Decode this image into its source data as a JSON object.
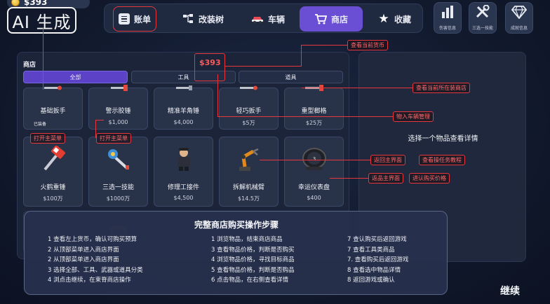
{
  "currency": {
    "amount": "$393"
  },
  "watermark": {
    "text": "AI 生成"
  },
  "nav": {
    "tabs": [
      {
        "label": "账单",
        "icon": "bill-icon"
      },
      {
        "label": "改装树",
        "icon": "tree-icon"
      },
      {
        "label": "车辆",
        "icon": "car-icon"
      },
      {
        "label": "商店",
        "icon": "cart-icon",
        "active": true
      },
      {
        "label": "收藏",
        "icon": "star-icon"
      }
    ],
    "right_buttons": [
      {
        "label": "伤害信息",
        "icon": "bar-chart-icon"
      },
      {
        "label": "三选一技能",
        "icon": "tools-icon"
      },
      {
        "label": "成就信息",
        "icon": "diamond-icon"
      }
    ]
  },
  "shop": {
    "title": "商店",
    "filters": [
      "全部",
      "工具",
      "道具"
    ],
    "items_row1": [
      {
        "name": "基础扳手",
        "price": "",
        "badge": "已装备"
      },
      {
        "name": "警示胶锤",
        "price": "$1,000"
      },
      {
        "name": "精准羊角锤",
        "price": "$4,000"
      },
      {
        "name": "轻巧扳手",
        "price": "$5万"
      },
      {
        "name": "重型榔格",
        "price": "$25万"
      }
    ],
    "items_row2": [
      {
        "name": "火鹤重锤",
        "price": "$100万",
        "icon": "hammer-icon"
      },
      {
        "name": "三选一技能",
        "price": "$1000万",
        "icon": "mace-icon"
      },
      {
        "name": "修理工接件",
        "price": "$4,500",
        "icon": "mechanic-icon"
      },
      {
        "name": "拆解机械臂",
        "price": "$14.5万",
        "icon": "robot-arm-icon"
      },
      {
        "name": "幸运仪表盘",
        "price": "$400",
        "icon": "gauge-icon"
      }
    ]
  },
  "detail": {
    "hint": "选择一个物品查看详情"
  },
  "guide": {
    "title": "完整商店购买操作步骤",
    "col1": [
      "1 查看左上货币，确认可购买预算",
      "2 从顶部菜单进入商店界面",
      "2 从顶部菜单进入商店界面",
      "3 选择全部、工具、武器或道具分类",
      "4 浏点击继续，在束脊商店操作"
    ],
    "col2": [
      "1 浏览物品，结束商店商品",
      "3 查看物品价格，判断是否购买",
      "4 浏览物品价格，寻找目标商品",
      "5 查看物品价格，判断是否购品",
      "6 点击物品，在右侧查看详情"
    ],
    "col3": [
      "7 查认购买后返回游戏",
      "7 查看工具类商品",
      "7. 查看购买后返回游戏",
      "8 查看选中物品详情",
      "8 返回游戏或确认"
    ]
  },
  "continue_label": "继续",
  "annotations": {
    "price": "$393",
    "view_currency": "查看当前货币",
    "view_shop": "查看当前所在装商店",
    "vehicle_mgmt": "物入车辆管理",
    "open_menu_1": "打开主菜单",
    "open_menu_2": "打开主菜单",
    "back_main": "返回主界面",
    "view_tasks": "查看操任务教程",
    "back_main_2": "返品主界面",
    "enter_purchase": "进认购买价格"
  },
  "colors": {
    "accent": "#6a4fd4",
    "annotation": "#e8373c",
    "background": "#121a2e"
  }
}
